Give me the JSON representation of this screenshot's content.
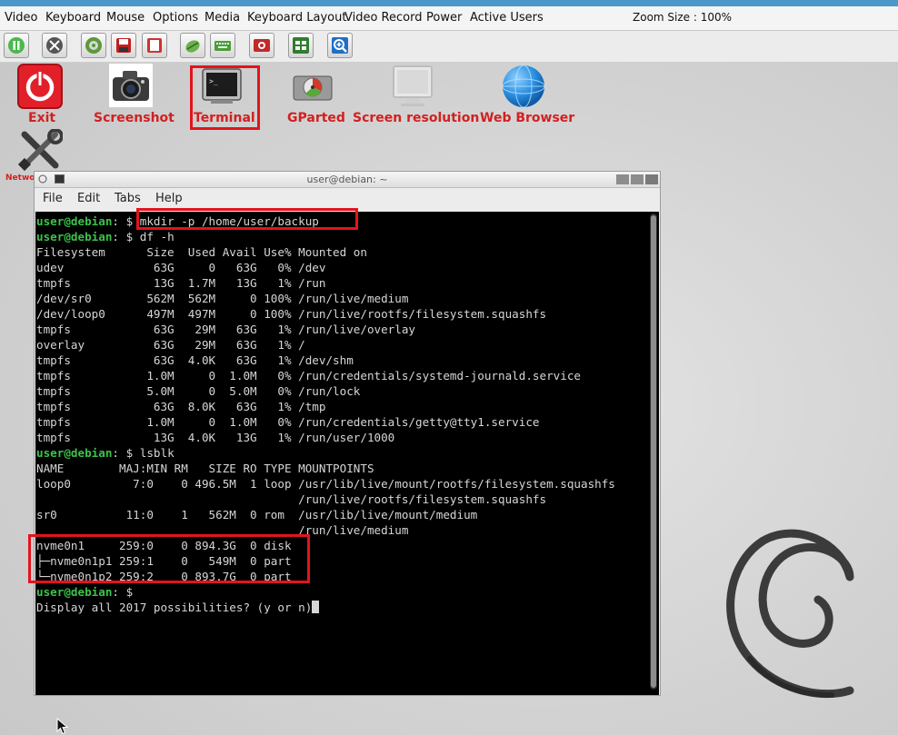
{
  "menubar": {
    "items": [
      "Video",
      "Keyboard",
      "Mouse",
      "Options",
      "Media",
      "Keyboard Layout",
      "Video Record",
      "Power",
      "Active Users"
    ],
    "zoom_label": "Zoom Size : 100%"
  },
  "toolbar": {
    "buttons": [
      "pause-icon",
      "fullscreen-icon",
      "disc-icon",
      "save-icon",
      "floppy-icon",
      "mouse-icon",
      "keyboard-icon",
      "record-icon",
      "multi-window-icon",
      "zoom-in-icon"
    ]
  },
  "desktop": {
    "icons": [
      {
        "label": "Exit",
        "icon": "power-icon"
      },
      {
        "label": "Screenshot",
        "icon": "camera-icon"
      },
      {
        "label": "Terminal",
        "icon": "terminal-icon"
      },
      {
        "label": "GParted",
        "icon": "disk-icon"
      },
      {
        "label": "Screen resolution",
        "icon": "monitor-icon"
      },
      {
        "label": "Web Browser",
        "icon": "globe-icon"
      },
      {
        "label": "Netwo",
        "icon": "tools-icon"
      }
    ]
  },
  "terminal": {
    "title": "user@debian: ~",
    "menu": [
      "File",
      "Edit",
      "Tabs",
      "Help"
    ],
    "prompt": "user@debian",
    "lines": [
      {
        "p": true,
        "t": ": $ mkdir -p /home/user/backup"
      },
      {
        "p": true,
        "t": ": $ df -h"
      },
      {
        "p": false,
        "t": "Filesystem      Size  Used Avail Use% Mounted on"
      },
      {
        "p": false,
        "t": "udev             63G     0   63G   0% /dev"
      },
      {
        "p": false,
        "t": "tmpfs            13G  1.7M   13G   1% /run"
      },
      {
        "p": false,
        "t": "/dev/sr0        562M  562M     0 100% /run/live/medium"
      },
      {
        "p": false,
        "t": "/dev/loop0      497M  497M     0 100% /run/live/rootfs/filesystem.squashfs"
      },
      {
        "p": false,
        "t": "tmpfs            63G   29M   63G   1% /run/live/overlay"
      },
      {
        "p": false,
        "t": "overlay          63G   29M   63G   1% /"
      },
      {
        "p": false,
        "t": "tmpfs            63G  4.0K   63G   1% /dev/shm"
      },
      {
        "p": false,
        "t": "tmpfs           1.0M     0  1.0M   0% /run/credentials/systemd-journald.service"
      },
      {
        "p": false,
        "t": "tmpfs           5.0M     0  5.0M   0% /run/lock"
      },
      {
        "p": false,
        "t": "tmpfs            63G  8.0K   63G   1% /tmp"
      },
      {
        "p": false,
        "t": "tmpfs           1.0M     0  1.0M   0% /run/credentials/getty@tty1.service"
      },
      {
        "p": false,
        "t": "tmpfs            13G  4.0K   13G   1% /run/user/1000"
      },
      {
        "p": true,
        "t": ": $ lsblk"
      },
      {
        "p": false,
        "t": "NAME        MAJ:MIN RM   SIZE RO TYPE MOUNTPOINTS"
      },
      {
        "p": false,
        "t": "loop0         7:0    0 496.5M  1 loop /usr/lib/live/mount/rootfs/filesystem.squashfs"
      },
      {
        "p": false,
        "t": "                                      /run/live/rootfs/filesystem.squashfs"
      },
      {
        "p": false,
        "t": "sr0          11:0    1   562M  0 rom  /usr/lib/live/mount/medium"
      },
      {
        "p": false,
        "t": "                                      /run/live/medium"
      },
      {
        "p": false,
        "t": "nvme0n1     259:0    0 894.3G  0 disk"
      },
      {
        "p": false,
        "t": "├─nvme0n1p1 259:1    0   549M  0 part"
      },
      {
        "p": false,
        "t": "└─nvme0n1p2 259:2    0 893.7G  0 part"
      },
      {
        "p": true,
        "t": ": $"
      },
      {
        "p": false,
        "t": "Display all 2017 possibilities? (y or n)",
        "cursor": true
      }
    ]
  },
  "colors": {
    "prompt": "#3cc24a",
    "highlight": "#e2141e",
    "label": "#d22020"
  }
}
